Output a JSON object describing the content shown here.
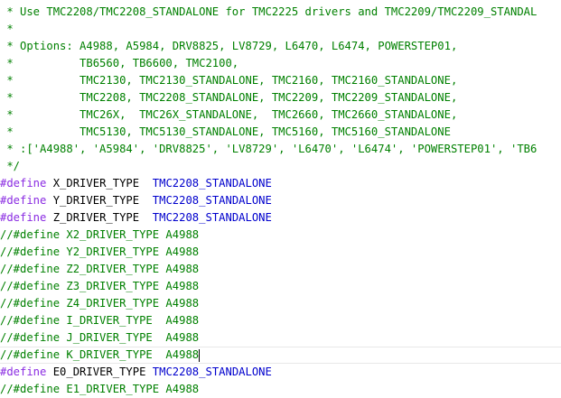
{
  "colors": {
    "comment": "#008000",
    "directive": "#8a2be2",
    "macro_name": "#000000",
    "macro_value": "#0000cd",
    "background": "#ffffff"
  },
  "editor": {
    "cursor_line_index": 21,
    "lines": [
      {
        "segments": [
          {
            "type": "comment",
            "text": " * Use TMC2208/TMC2208_STANDALONE for TMC2225 drivers and TMC2209/TMC2209_STANDAL"
          }
        ]
      },
      {
        "segments": [
          {
            "type": "comment",
            "text": " *"
          }
        ]
      },
      {
        "segments": [
          {
            "type": "comment",
            "text": " * Options: A4988, A5984, DRV8825, LV8729, L6470, L6474, POWERSTEP01,"
          }
        ]
      },
      {
        "segments": [
          {
            "type": "comment",
            "text": " *          TB6560, TB6600, TMC2100,"
          }
        ]
      },
      {
        "segments": [
          {
            "type": "comment",
            "text": " *          TMC2130, TMC2130_STANDALONE, TMC2160, TMC2160_STANDALONE,"
          }
        ]
      },
      {
        "segments": [
          {
            "type": "comment",
            "text": " *          TMC2208, TMC2208_STANDALONE, TMC2209, TMC2209_STANDALONE,"
          }
        ]
      },
      {
        "segments": [
          {
            "type": "comment",
            "text": " *          TMC26X,  TMC26X_STANDALONE,  TMC2660, TMC2660_STANDALONE,"
          }
        ]
      },
      {
        "segments": [
          {
            "type": "comment",
            "text": " *          TMC5130, TMC5130_STANDALONE, TMC5160, TMC5160_STANDALONE"
          }
        ]
      },
      {
        "segments": [
          {
            "type": "comment",
            "text": " * :['A4988', 'A5984', 'DRV8825', 'LV8729', 'L6470', 'L6474', 'POWERSTEP01', 'TB6"
          }
        ]
      },
      {
        "segments": [
          {
            "type": "comment",
            "text": " */"
          }
        ]
      },
      {
        "segments": [
          {
            "type": "directive",
            "text": "#define"
          },
          {
            "type": "macro_name",
            "text": " X_DRIVER_TYPE  "
          },
          {
            "type": "macro_value",
            "text": "TMC2208_STANDALONE"
          }
        ]
      },
      {
        "segments": [
          {
            "type": "directive",
            "text": "#define"
          },
          {
            "type": "macro_name",
            "text": " Y_DRIVER_TYPE  "
          },
          {
            "type": "macro_value",
            "text": "TMC2208_STANDALONE"
          }
        ]
      },
      {
        "segments": [
          {
            "type": "directive",
            "text": "#define"
          },
          {
            "type": "macro_name",
            "text": " Z_DRIVER_TYPE  "
          },
          {
            "type": "macro_value",
            "text": "TMC2208_STANDALONE"
          }
        ]
      },
      {
        "segments": [
          {
            "type": "comment",
            "text": "//#define X2_DRIVER_TYPE A4988"
          }
        ]
      },
      {
        "segments": [
          {
            "type": "comment",
            "text": "//#define Y2_DRIVER_TYPE A4988"
          }
        ]
      },
      {
        "segments": [
          {
            "type": "comment",
            "text": "//#define Z2_DRIVER_TYPE A4988"
          }
        ]
      },
      {
        "segments": [
          {
            "type": "comment",
            "text": "//#define Z3_DRIVER_TYPE A4988"
          }
        ]
      },
      {
        "segments": [
          {
            "type": "comment",
            "text": "//#define Z4_DRIVER_TYPE A4988"
          }
        ]
      },
      {
        "segments": [
          {
            "type": "comment",
            "text": "//#define I_DRIVER_TYPE  A4988"
          }
        ]
      },
      {
        "segments": [
          {
            "type": "comment",
            "text": "//#define J_DRIVER_TYPE  A4988"
          }
        ]
      },
      {
        "segments": [
          {
            "type": "comment",
            "text": "//#define K_DRIVER_TYPE  A4988"
          }
        ]
      },
      {
        "segments": [
          {
            "type": "directive",
            "text": "#define"
          },
          {
            "type": "macro_name",
            "text": " E0_DRIVER_TYPE "
          },
          {
            "type": "macro_value",
            "text": "TMC2208_STANDALONE"
          }
        ]
      },
      {
        "segments": [
          {
            "type": "comment",
            "text": "//#define E1_DRIVER_TYPE A4988"
          }
        ]
      }
    ]
  }
}
